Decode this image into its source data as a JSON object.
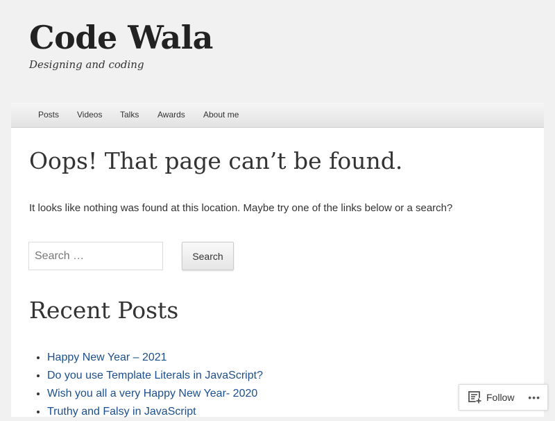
{
  "site": {
    "title": "Code Wala",
    "tagline": "Designing and coding"
  },
  "nav": {
    "items": [
      {
        "label": "Posts"
      },
      {
        "label": "Videos"
      },
      {
        "label": "Talks"
      },
      {
        "label": "Awards"
      },
      {
        "label": "About me"
      }
    ]
  },
  "main": {
    "title": "Oops! That page can’t be found.",
    "message": "It looks like nothing was found at this location. Maybe try one of the links below or a search?",
    "search": {
      "placeholder": "Search …",
      "value": "",
      "button_label": "Search"
    },
    "recent_posts": {
      "title": "Recent Posts",
      "items": [
        {
          "label": "Happy New Year – 2021"
        },
        {
          "label": "Do you use Template Literals in JavaScript?"
        },
        {
          "label": "Wish you all a very Happy New Year- 2020"
        },
        {
          "label": "Truthy and Falsy in JavaScript"
        }
      ]
    }
  },
  "follow_widget": {
    "label": "Follow",
    "icon": "reader-follow-icon",
    "more_icon": "ellipsis-icon"
  },
  "colors": {
    "page_background": "#f1f1f1",
    "content_background": "#ffffff",
    "link": "#1c4f8d",
    "text": "#333333"
  }
}
